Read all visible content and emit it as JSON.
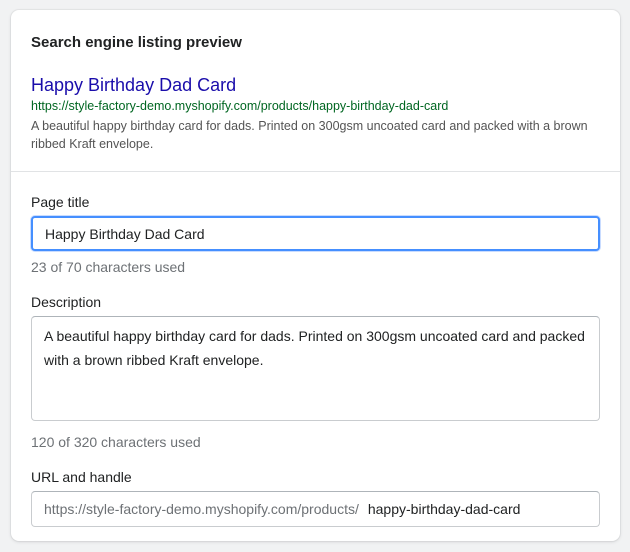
{
  "card": {
    "title": "Search engine listing preview"
  },
  "preview": {
    "title": "Happy Birthday Dad Card",
    "url": "https://style-factory-demo.myshopify.com/products/happy-birthday-dad-card",
    "description": "A beautiful happy birthday card for dads. Printed on 300gsm uncoated card and packed with a brown ribbed Kraft envelope.",
    "title_color": "#1a0dab",
    "url_color": "#006621"
  },
  "page_title": {
    "label": "Page title",
    "value": "Happy Birthday Dad Card",
    "help": "23 of 70 characters used"
  },
  "description": {
    "label": "Description",
    "value": "A beautiful happy birthday card for dads. Printed on 300gsm uncoated card and packed with a brown ribbed Kraft envelope.",
    "help": "120 of 320 characters used"
  },
  "url_handle": {
    "label": "URL and handle",
    "prefix": "https://style-factory-demo.myshopify.com/products/",
    "value": "happy-birthday-dad-card"
  },
  "colors": {
    "focus_ring": "#458fff"
  }
}
